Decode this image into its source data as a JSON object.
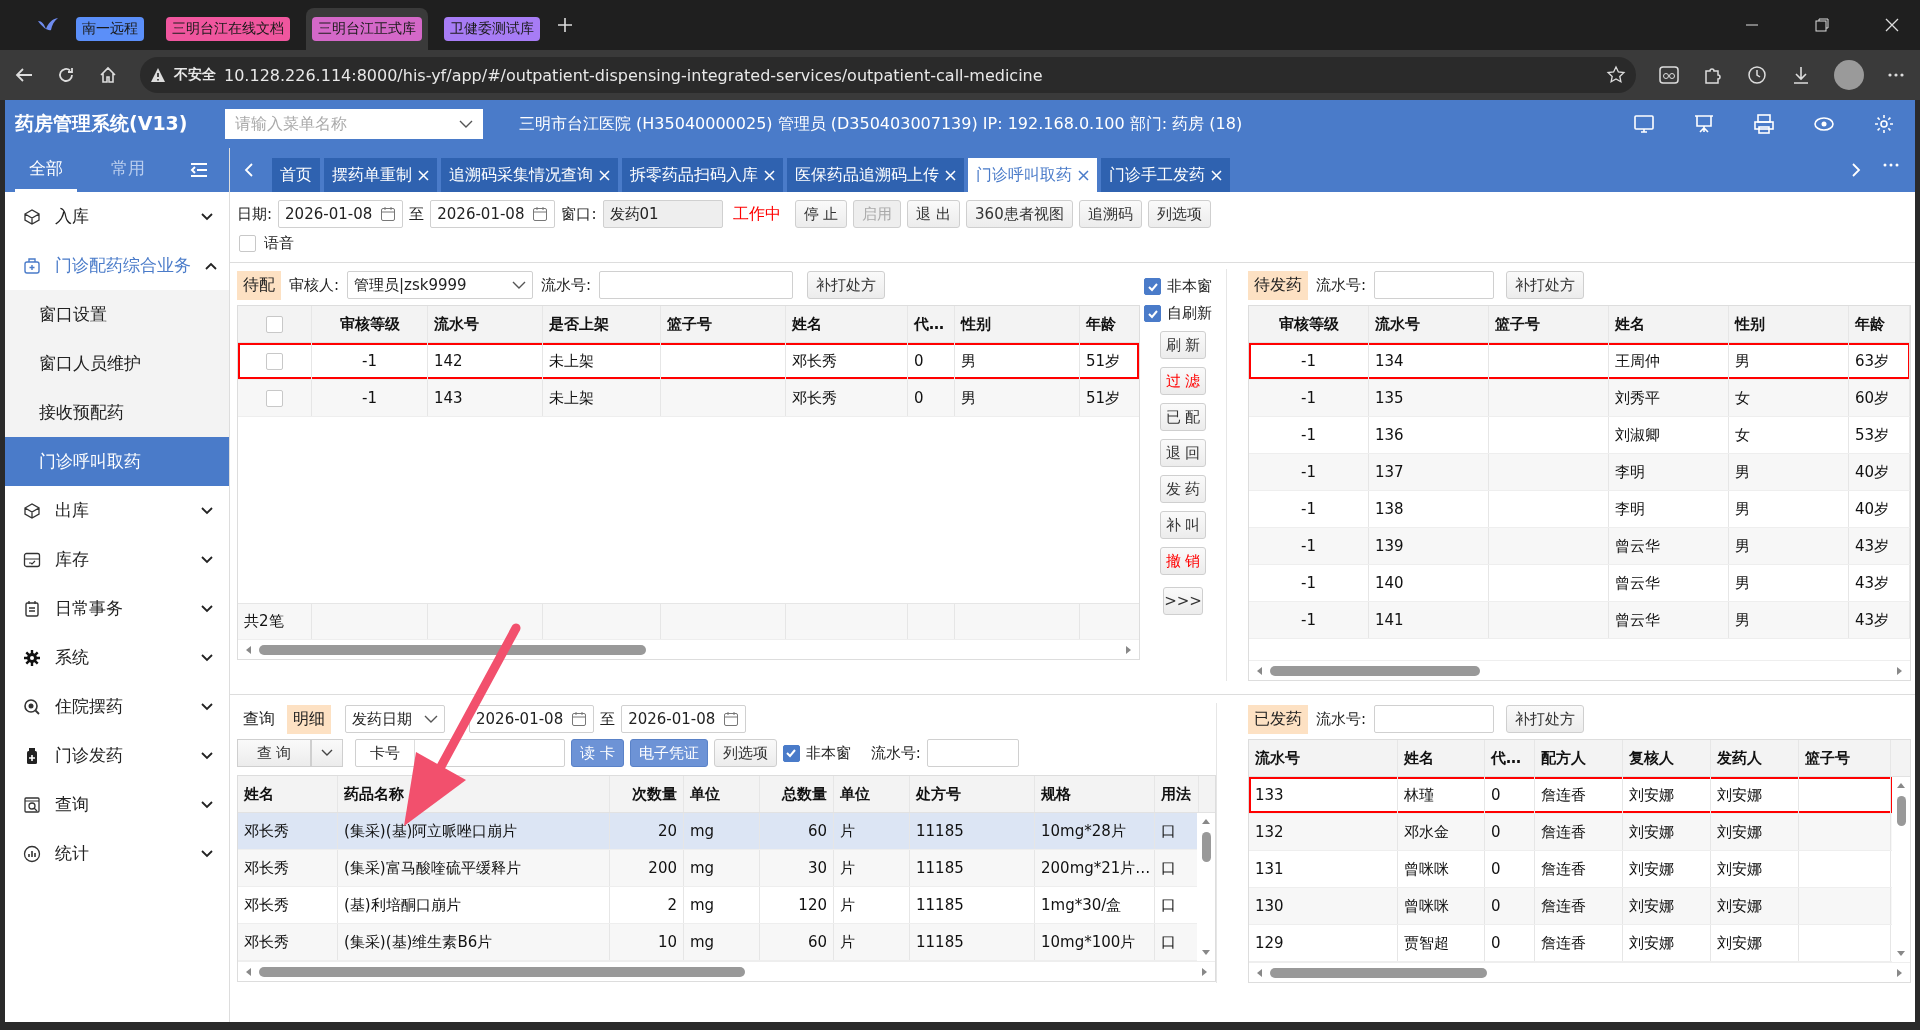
{
  "browser": {
    "tabs": [
      {
        "label": "南一远程",
        "color": "#5b8ff9",
        "selected": false
      },
      {
        "label": "三明台江在线文档",
        "color": "#f0569e",
        "selected": false
      },
      {
        "label": "三明台江正式库",
        "color": "#d468c8",
        "selected": true
      },
      {
        "label": "卫健委测试库",
        "color": "#a77cf5",
        "selected": false
      }
    ],
    "security": "不安全",
    "url": "10.128.226.114:8000/his-yf/app/#/outpatient-dispensing-integrated-services/outpatient-call-medicine"
  },
  "header": {
    "title": "药房管理系统(V13)",
    "menu_search": {
      "placeholder": "请输入菜单名称"
    },
    "info": "三明市台江医院 (H35040000025) 管理员 (D350403007139) IP: 192.168.0.100 部门: 药房 (18)"
  },
  "sidebar": {
    "tabs": [
      {
        "label": "全部",
        "selected": true
      },
      {
        "label": "常用",
        "selected": false
      }
    ],
    "items": [
      {
        "label": "入库",
        "expanded": false
      },
      {
        "label": "门诊配药综合业务",
        "expanded": true,
        "children": [
          {
            "label": "窗口设置",
            "selected": false
          },
          {
            "label": "窗口人员维护",
            "selected": false
          },
          {
            "label": "接收预配药",
            "selected": false
          },
          {
            "label": "门诊呼叫取药",
            "selected": true
          }
        ]
      },
      {
        "label": "出库",
        "expanded": false
      },
      {
        "label": "库存",
        "expanded": false
      },
      {
        "label": "日常事务",
        "expanded": false
      },
      {
        "label": "系统",
        "expanded": false
      },
      {
        "label": "住院摆药",
        "expanded": false
      },
      {
        "label": "门诊发药",
        "expanded": false
      },
      {
        "label": "查询",
        "expanded": false
      },
      {
        "label": "统计",
        "expanded": false
      }
    ]
  },
  "page_tabs": [
    {
      "label": "首页",
      "selected": false,
      "closable": false
    },
    {
      "label": "摆药单重制",
      "selected": false,
      "closable": true
    },
    {
      "label": "追溯码采集情况查询",
      "selected": false,
      "closable": true
    },
    {
      "label": "拆零药品扫码入库",
      "selected": false,
      "closable": true
    },
    {
      "label": "医保药品追溯码上传",
      "selected": false,
      "closable": true
    },
    {
      "label": "门诊呼叫取药",
      "selected": true,
      "closable": true
    },
    {
      "label": "门诊手工发药",
      "selected": false,
      "closable": true
    }
  ],
  "toolbar": {
    "date_label": "日期:",
    "date_from": "2026-01-08",
    "to_label": "至",
    "date_to": "2026-01-08",
    "window_label": "窗口:",
    "window": "发药01",
    "status": "工作中",
    "buttons": [
      {
        "label": "停 止",
        "disabled": false
      },
      {
        "label": "启用",
        "disabled": true
      },
      {
        "label": "退 出",
        "disabled": false
      },
      {
        "label": "360患者视图",
        "disabled": false
      },
      {
        "label": "追溯码",
        "disabled": false
      },
      {
        "label": "列选项",
        "disabled": false
      }
    ],
    "voice": {
      "label": "语音",
      "checked": false
    }
  },
  "pending": {
    "tag": "待配",
    "reviewer_label": "审核人:",
    "reviewer": "管理员|zsk9999",
    "serial_label": "流水号:",
    "reprint_button": "补打处方",
    "all_checked": false,
    "columns": [
      "审核等级",
      "流水号",
      "是否上架",
      "篮子号",
      "姓名",
      "代…",
      "性别",
      "年龄"
    ],
    "rows": [
      {
        "checked": false,
        "selected": true,
        "cells": [
          "-1",
          "142",
          "未上架",
          null,
          "邓长秀",
          "0",
          "男",
          "51岁"
        ]
      },
      {
        "checked": false,
        "selected": false,
        "cells": [
          "-1",
          "143",
          "未上架",
          null,
          "邓长秀",
          "0",
          "男",
          "51岁"
        ]
      }
    ],
    "footer": "共2笔"
  },
  "side_controls": {
    "options": [
      {
        "label": "非本窗",
        "checked": true
      },
      {
        "label": "自刷新",
        "checked": true
      }
    ],
    "actions": [
      {
        "label": "刷 新",
        "alert": false
      },
      {
        "label": "过 滤",
        "alert": true
      },
      {
        "label": "已 配",
        "alert": false
      },
      {
        "label": "退 回",
        "alert": false
      },
      {
        "label": "发 药",
        "alert": false
      },
      {
        "label": "补 叫",
        "alert": false
      },
      {
        "label": "撤 销",
        "alert": true
      },
      {
        "label": ">>>",
        "alert": false
      }
    ]
  },
  "to_dispense": {
    "tag": "待发药",
    "serial_label": "流水号:",
    "reprint_button": "补打处方",
    "columns": [
      "审核等级",
      "流水号",
      "篮子号",
      "姓名",
      "性别",
      "年龄"
    ],
    "rows": [
      {
        "selected": true,
        "cells": [
          "-1",
          "134",
          null,
          "王周仲",
          "男",
          "63岁"
        ]
      },
      {
        "selected": false,
        "cells": [
          "-1",
          "135",
          null,
          "刘秀平",
          "女",
          "60岁"
        ]
      },
      {
        "selected": false,
        "cells": [
          "-1",
          "136",
          null,
          "刘淑卿",
          "女",
          "53岁"
        ]
      },
      {
        "selected": false,
        "cells": [
          "-1",
          "137",
          null,
          "李明",
          "男",
          "40岁"
        ]
      },
      {
        "selected": false,
        "cells": [
          "-1",
          "138",
          null,
          "李明",
          "男",
          "40岁"
        ]
      },
      {
        "selected": false,
        "cells": [
          "-1",
          "139",
          null,
          "曾云华",
          "男",
          "43岁"
        ]
      },
      {
        "selected": false,
        "cells": [
          "-1",
          "140",
          null,
          "曾云华",
          "男",
          "43岁"
        ]
      },
      {
        "selected": false,
        "cells": [
          "-1",
          "141",
          null,
          "曾云华",
          "男",
          "43岁"
        ]
      }
    ]
  },
  "detail": {
    "modes": [
      {
        "label": "查询",
        "selected": false
      },
      {
        "label": "明细",
        "selected": true
      }
    ],
    "date_type": "发药日期",
    "date_from": "2026-01-08",
    "to_label": "至",
    "date_to": "2026-01-08",
    "query_button": "查 询",
    "card_label": "卡号",
    "read_card_button": "读 卡",
    "evoucher_button": "电子凭证",
    "column_options_button": "列选项",
    "not_window": {
      "label": "非本窗",
      "checked": true
    },
    "serial_label": "流水号:",
    "columns": [
      "姓名",
      "药品名称",
      "次数量",
      "单位",
      "总数量",
      "单位",
      "处方号",
      "规格",
      "用法"
    ],
    "rows": [
      {
        "selected": true,
        "cells": [
          "邓长秀",
          "(集采)(基)阿立哌唑口崩片",
          "20",
          "mg",
          "60",
          "片",
          "11185",
          "10mg*28片",
          "口"
        ]
      },
      {
        "selected": false,
        "cells": [
          "邓长秀",
          "(集采)富马酸喹硫平缓释片",
          "200",
          "mg",
          "30",
          "片",
          "11185",
          "200mg*21片…",
          "口"
        ]
      },
      {
        "selected": false,
        "cells": [
          "邓长秀",
          "(基)利培酮口崩片",
          "2",
          "mg",
          "120",
          "片",
          "11185",
          "1mg*30/盒",
          "口"
        ]
      },
      {
        "selected": false,
        "cells": [
          "邓长秀",
          "(集采)(基)维生素B6片",
          "10",
          "mg",
          "60",
          "片",
          "11185",
          "10mg*100片",
          "口"
        ]
      }
    ]
  },
  "dispensed": {
    "tag": "已发药",
    "serial_label": "流水号:",
    "reprint_button": "补打处方",
    "columns": [
      "流水号",
      "姓名",
      "代…",
      "配方人",
      "复核人",
      "发药人",
      "篮子号"
    ],
    "rows": [
      {
        "selected": true,
        "cells": [
          "133",
          "林瑾",
          "0",
          "詹连香",
          "刘安娜",
          "刘安娜",
          null
        ]
      },
      {
        "selected": false,
        "cells": [
          "132",
          "邓水金",
          "0",
          "詹连香",
          "刘安娜",
          "刘安娜",
          null
        ]
      },
      {
        "selected": false,
        "cells": [
          "131",
          "曾咪咪",
          "0",
          "詹连香",
          "刘安娜",
          "刘安娜",
          null
        ]
      },
      {
        "selected": false,
        "cells": [
          "130",
          "曾咪咪",
          "0",
          "詹连香",
          "刘安娜",
          "刘安娜",
          null
        ]
      },
      {
        "selected": false,
        "cells": [
          "129",
          "贾智超",
          "0",
          "詹连香",
          "刘安娜",
          "刘安娜",
          null
        ]
      }
    ]
  }
}
